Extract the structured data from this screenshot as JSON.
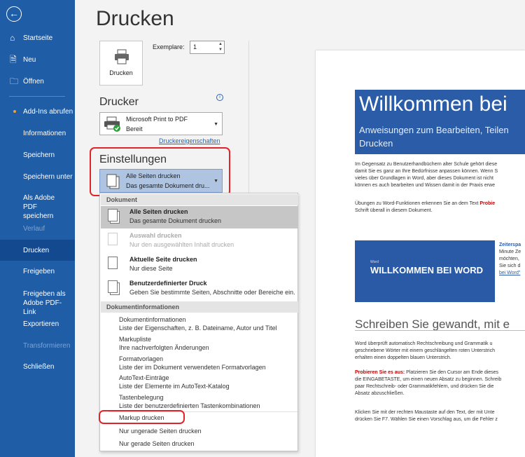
{
  "nav": {
    "items": [
      {
        "label": "Startseite",
        "icon": "home-icon"
      },
      {
        "label": "Neu",
        "icon": "new-document-icon"
      },
      {
        "label": "Öffnen",
        "icon": "folder-icon"
      },
      {
        "label": "Add-Ins abrufen"
      },
      {
        "label": "Informationen"
      },
      {
        "label": "Speichern"
      },
      {
        "label": "Speichern unter"
      },
      {
        "label": "Als Adobe PDF speichern"
      },
      {
        "label": "Verlauf"
      },
      {
        "label": "Drucken"
      },
      {
        "label": "Freigeben"
      },
      {
        "label": "Freigeben als Adobe PDF-Link"
      },
      {
        "label": "Exportieren"
      },
      {
        "label": "Transformieren"
      },
      {
        "label": "Schließen"
      }
    ]
  },
  "page": {
    "title": "Drucken"
  },
  "print": {
    "button_label": "Drucken",
    "copies_label": "Exemplare:",
    "copies_value": "1"
  },
  "printer": {
    "section_title": "Drucker",
    "name": "Microsoft Print to PDF",
    "status": "Bereit",
    "properties_link": "Druckereigenschaften"
  },
  "settings": {
    "section_title": "Einstellungen",
    "selected_title": "Alle Seiten drucken",
    "selected_desc": "Das gesamte Dokument dru..."
  },
  "menu": {
    "head1": "Dokument",
    "items": [
      {
        "title": "Alle Seiten drucken",
        "desc": "Das gesamte Dokument drucken"
      },
      {
        "title": "Auswahl drucken",
        "desc": "Nur den ausgewählten Inhalt drucken"
      },
      {
        "title": "Aktuelle Seite drucken",
        "desc": "Nur diese Seite"
      },
      {
        "title": "Benutzerdefinierter Druck",
        "desc": "Geben Sie bestimmte Seiten, Abschnitte oder Bereiche ein."
      }
    ],
    "head2": "Dokumentinformationen",
    "info_lines": [
      "Dokumentinformationen",
      "Liste der Eigenschaften, z. B. Dateiname, Autor und Titel",
      "Markupliste",
      "Ihre nachverfolgten Änderungen",
      "Formatvorlagen",
      "Liste der im Dokument verwendeten Formatvorlagen",
      "AutoText-Einträge",
      "Liste der Elemente im AutoText-Katalog",
      "Tastenbelegung",
      "Liste der benutzerdefinierten Tastenkombinationen"
    ],
    "markup": "Markup drucken",
    "odd": "Nur ungerade Seiten drucken",
    "even": "Nur gerade Seiten drucken"
  },
  "preview": {
    "banner_title": "Willkommen bei",
    "banner_sub1": "Anweisungen zum Bearbeiten, Teilen",
    "banner_sub2": "Drucken",
    "p1": [
      "Im Gegensatz zu Benutzerhandbüchern alter Schule gehört diese",
      "damit Sie es ganz an Ihre Bedürfnisse anpassen können. Wenn S",
      "vieles über Grundlagen in Word, aber dieses Dokument ist nicht",
      "können es auch bearbeiten und Wissen damit in der Praxis erwe"
    ],
    "p2a": "Übungen zu Word-Funktionen erkennen Sie an dem Text ",
    "p2b": "Probie",
    "p2c": "Schrift überall in diesem Dokument.",
    "side_bold": "Zeiterspa",
    "side_lines": [
      "Minute Ze",
      "möchten,",
      "Sie sich d"
    ],
    "side_link": "bei Word\"",
    "box_small": "Word",
    "box_big": "WILLKOMMEN BEI WORD",
    "h2": "Schreiben Sie gewandt, mit e",
    "p3": [
      "Word überprüft automatisch Rechtschreibung und Grammatik u",
      "geschriebene Wörter mit einem geschlängelten roten Unterstrich",
      "erhalten einen doppelten blauen Unterstrich."
    ],
    "p4a": "Probieren Sie es aus:",
    "p4b": " Platzieren Sie den Cursor am Ende dieses",
    "p4": [
      "die EINGABETASTE, um einen neuen Absatz zu beginnen. Schreib",
      "paar Rechtschreib- oder Grammatikfehlern, und drücken Sie die",
      "Absatz abzuschließen."
    ],
    "p5": [
      "Klicken Sie mit der rechten Maustaste auf den Text, der mit Unte",
      "drücken Sie F7. Wählen Sie einen Vorschlag aus, um die Fehler z"
    ]
  }
}
